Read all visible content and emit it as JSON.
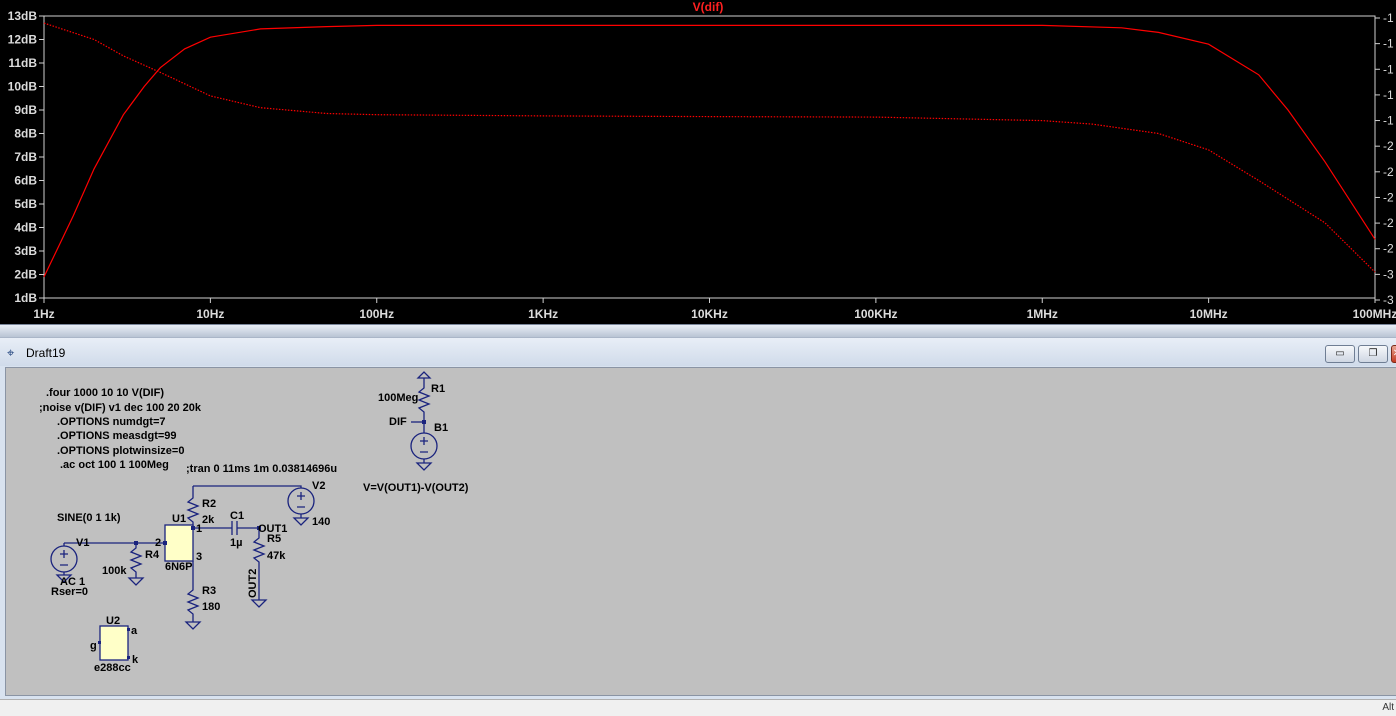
{
  "plot": {
    "title": "V(dif)",
    "y_ticks": [
      "13dB",
      "12dB",
      "11dB",
      "10dB",
      "9dB",
      "8dB",
      "7dB",
      "6dB",
      "5dB",
      "4dB",
      "3dB",
      "2dB",
      "1dB"
    ],
    "x_ticks": [
      "1Hz",
      "10Hz",
      "100Hz",
      "1KHz",
      "10KHz",
      "100KHz",
      "1MHz",
      "10MHz",
      "100MHz"
    ],
    "right_ticks": [
      "-1",
      "-1",
      "-1",
      "-1",
      "-1",
      "-2",
      "-2",
      "-2",
      "-2",
      "-2",
      "-3",
      "-3"
    ],
    "trace_color": "#ff0000",
    "background": "#000000",
    "gridlines": false
  },
  "chart_data": {
    "type": "line",
    "title": "V(dif)",
    "xlabel": "",
    "ylabel": "",
    "x_scale": "log",
    "xlim": [
      "1Hz",
      "100MHz"
    ],
    "ylim": [
      1,
      13
    ],
    "y_unit": "dB",
    "series": [
      {
        "style": "solid",
        "points": [
          [
            1,
            1.9
          ],
          [
            1.5,
            4.5
          ],
          [
            2,
            6.5
          ],
          [
            3,
            8.8
          ],
          [
            4,
            10.0
          ],
          [
            5,
            10.8
          ],
          [
            7,
            11.6
          ],
          [
            10,
            12.1
          ],
          [
            20,
            12.45
          ],
          [
            50,
            12.55
          ],
          [
            100,
            12.6
          ],
          [
            1000,
            12.6
          ],
          [
            10000,
            12.6
          ],
          [
            100000,
            12.6
          ],
          [
            1000000,
            12.6
          ],
          [
            3000000,
            12.5
          ],
          [
            5000000,
            12.3
          ],
          [
            10000000,
            11.8
          ],
          [
            20000000,
            10.5
          ],
          [
            30000000,
            9.0
          ],
          [
            50000000,
            6.8
          ],
          [
            100000000,
            3.5
          ]
        ]
      },
      {
        "style": "dotted",
        "points": [
          [
            1,
            12.7
          ],
          [
            2,
            12.0
          ],
          [
            3,
            11.3
          ],
          [
            5,
            10.6
          ],
          [
            10,
            9.6
          ],
          [
            20,
            9.1
          ],
          [
            50,
            8.85
          ],
          [
            100,
            8.8
          ],
          [
            1000,
            8.75
          ],
          [
            10000,
            8.72
          ],
          [
            100000,
            8.7
          ],
          [
            1000000,
            8.55
          ],
          [
            2000000,
            8.4
          ],
          [
            5000000,
            8.0
          ],
          [
            10000000,
            7.3
          ],
          [
            20000000,
            6.0
          ],
          [
            50000000,
            4.2
          ],
          [
            100000000,
            2.1
          ]
        ]
      }
    ]
  },
  "window": {
    "title": "Draft19",
    "minimize": "▭",
    "restore": "❐",
    "close": "✕"
  },
  "schematic": {
    "directives": [
      ".four 1000 10 10 V(DIF)",
      ";noise v(DIF) v1 dec 100 20 20k",
      ".OPTIONS numdgt=7",
      ".OPTIONS measdgt=99",
      ".OPTIONS plotwinsize=0",
      ".ac oct 100 1 100Meg",
      ";tran 0 11ms 1m 0.03814696u"
    ],
    "labels": {
      "r1": "R1",
      "r1_val": "100Meg",
      "dif": "DIF",
      "b1": "B1",
      "b1_expr": "V=V(OUT1)-V(OUT2)",
      "v2": "V2",
      "v2_val": "140",
      "r2": "R2",
      "r2_val": "2k",
      "c1": "C1",
      "c1_val": "1µ",
      "out1": "OUT1",
      "r5": "R5",
      "r5_val": "47k",
      "u1": "U1",
      "u1_model": "6N6P",
      "pin1": "1",
      "pin2": "2",
      "pin3": "3",
      "sine": "SINE(0 1 1k)",
      "v1": "V1",
      "ac": "AC 1",
      "rser": "Rser=0",
      "r4": "R4",
      "r4_val": "100k",
      "r3": "R3",
      "r3_val": "180",
      "out2": "OUT2",
      "u2": "U2",
      "u2_model": "e288cc",
      "pin_g": "g",
      "pin_a": "a",
      "pin_k": "k"
    }
  },
  "status": {
    "text": "Alt"
  }
}
